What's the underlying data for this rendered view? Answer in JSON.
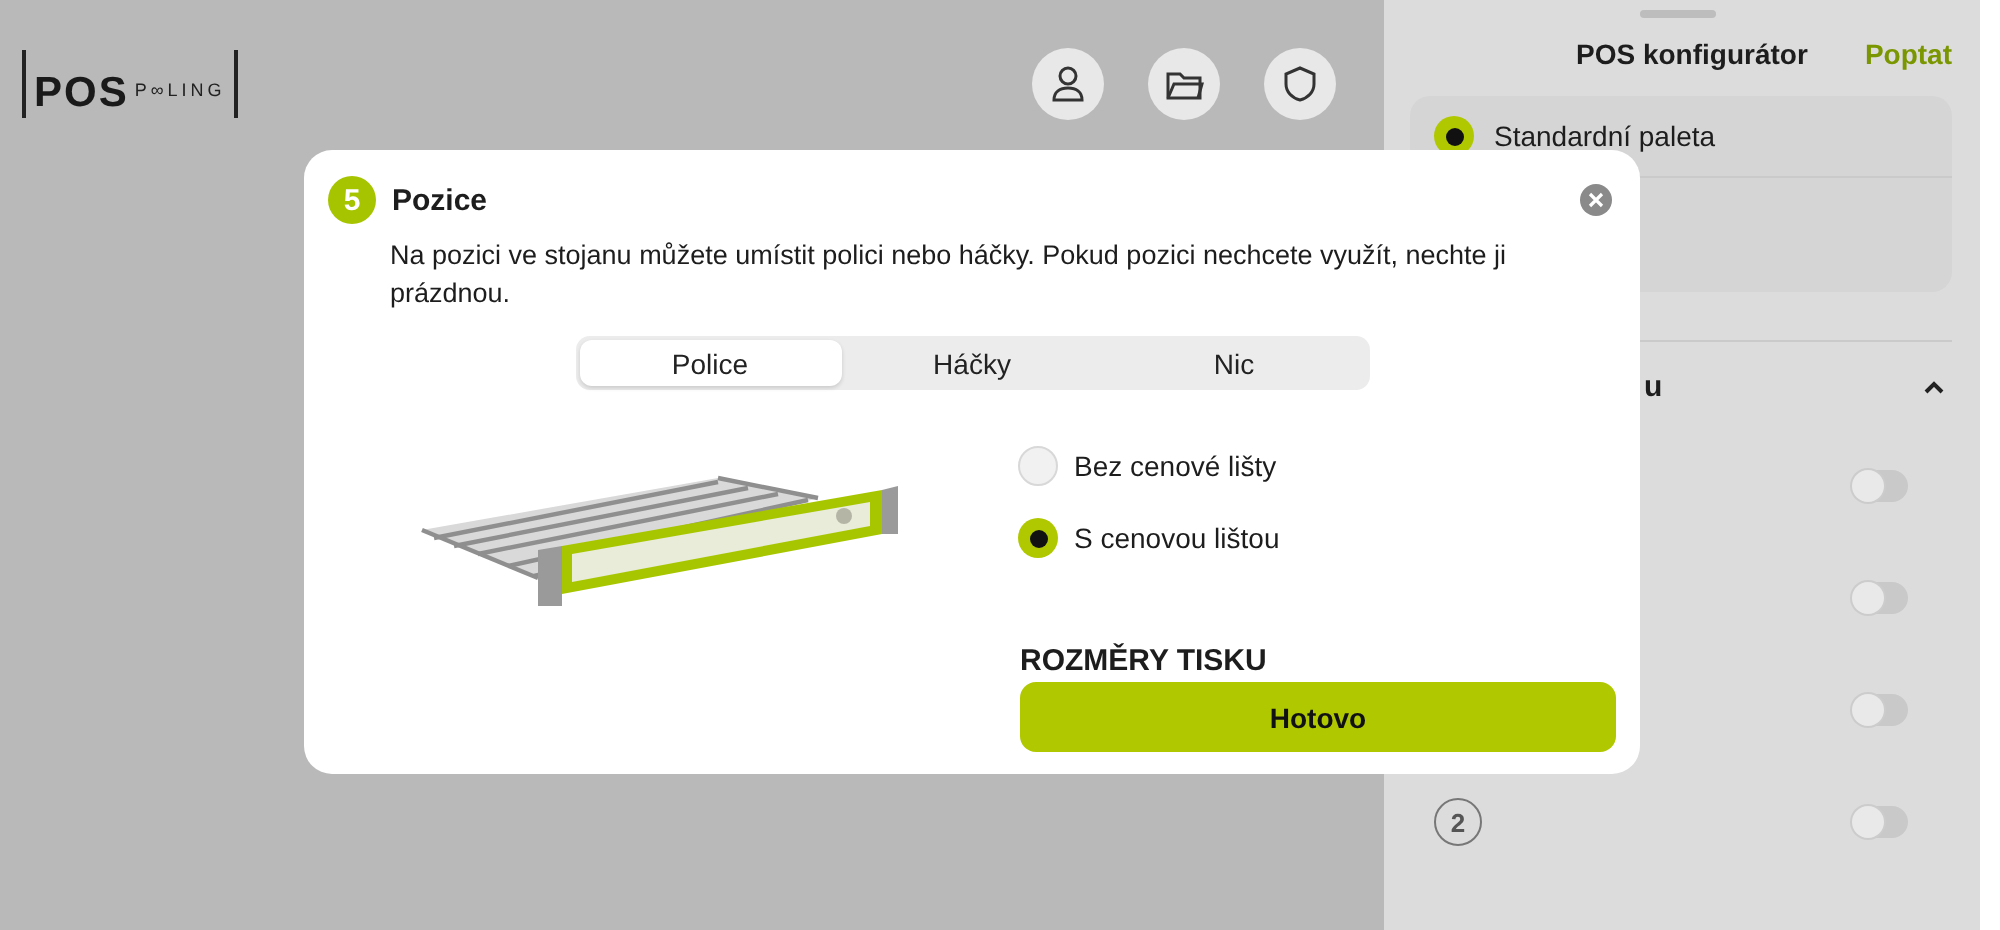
{
  "header": {
    "logo": {
      "word": "POS",
      "subword": "P∞LING"
    },
    "icons": [
      {
        "kind": "user"
      },
      {
        "kind": "folder"
      },
      {
        "kind": "shield"
      }
    ]
  },
  "panel": {
    "title": "POS konfigurátor",
    "action": "Poptat",
    "options": [
      {
        "label": "Standardní paleta",
        "selected": true
      }
    ],
    "section": {
      "title": "u",
      "expanded": true
    },
    "toggles": [
      {
        "on": false
      },
      {
        "on": false
      },
      {
        "on": false
      },
      {
        "badge": "2",
        "on": false
      }
    ]
  },
  "modal": {
    "step": "5",
    "title": "Pozice",
    "description": "Na pozici ve stojanu můžete umístit polici nebo háčky. Pokud pozici nechcete využít, nechte ji prázdnou.",
    "tabs": [
      {
        "label": "Police",
        "selected": true
      },
      {
        "label": "Háčky",
        "selected": false
      },
      {
        "label": "Nic",
        "selected": false
      }
    ],
    "options": [
      {
        "label": "Bez cenové lišty",
        "selected": false
      },
      {
        "label": "S cenovou lištou",
        "selected": true
      }
    ],
    "section_heading": "ROZMĚRY TISKU",
    "confirm": "Hotovo"
  }
}
